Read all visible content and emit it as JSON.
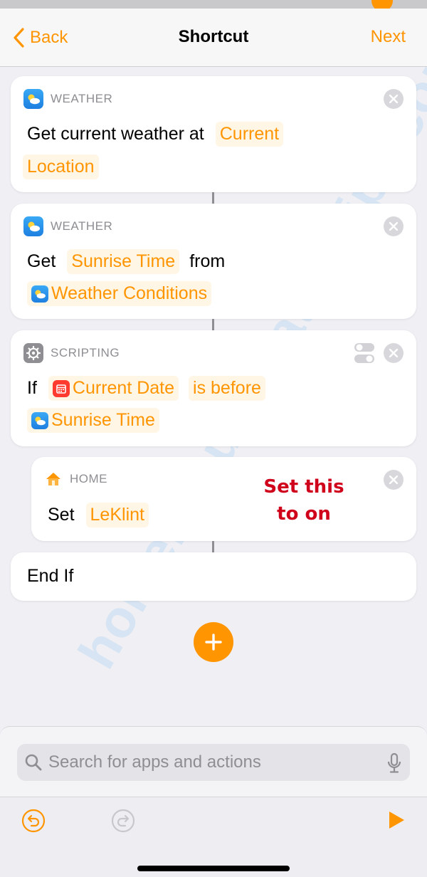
{
  "nav": {
    "back_label": "Back",
    "title": "Shortcut",
    "next_label": "Next"
  },
  "cards": [
    {
      "category": "WEATHER",
      "line1_text": "Get current weather at",
      "token_1": "Current",
      "token_2": "Location"
    },
    {
      "category": "WEATHER",
      "word_get": "Get",
      "token_sunrise": "Sunrise Time",
      "word_from": "from",
      "token_conditions": "Weather Conditions"
    },
    {
      "category": "SCRIPTING",
      "word_if": "If",
      "token_date": "Current Date",
      "token_condition": "is before",
      "token_sunrise": "Sunrise Time"
    },
    {
      "category": "HOME",
      "word_set": "Set",
      "token_device": "LeKlint"
    },
    {
      "label": "End If"
    }
  ],
  "annotation": {
    "line1": "Set this",
    "line2": "to on"
  },
  "watermark": "homekitautomationtips.com",
  "search": {
    "placeholder": "Search for apps and actions",
    "value": ""
  },
  "colors": {
    "accent": "#ff9500",
    "background": "#efeff4",
    "annotation": "#d0021b"
  },
  "icons": {
    "weather": "weather-icon",
    "scripting": "gear-icon",
    "home": "home-icon",
    "calendar": "calendar-icon",
    "close": "close-icon",
    "add": "plus-icon",
    "search": "search-icon",
    "mic": "microphone-icon",
    "undo": "undo-icon",
    "redo": "redo-icon",
    "play": "play-icon",
    "toggle": "toggle-icon"
  }
}
